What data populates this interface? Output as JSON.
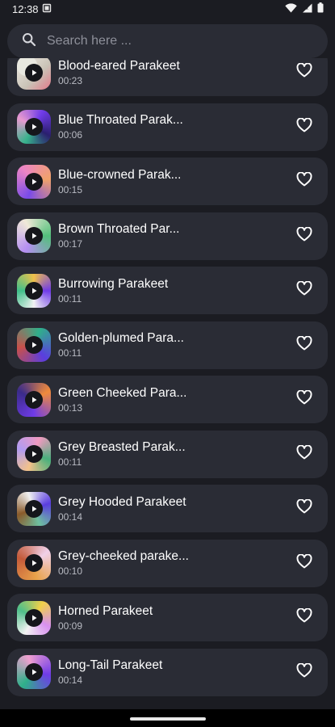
{
  "status_bar": {
    "time": "12:38"
  },
  "search": {
    "placeholder": "Search here ..."
  },
  "items": [
    {
      "title": "Blood-eared Parakeet",
      "duration": "00:23",
      "art": "a1"
    },
    {
      "title": "Blue Throated Parak...",
      "duration": "00:06",
      "art": "a2"
    },
    {
      "title": "Blue-crowned Parak...",
      "duration": "00:15",
      "art": "a3"
    },
    {
      "title": "Brown Throated Par...",
      "duration": "00:17",
      "art": "a4"
    },
    {
      "title": "Burrowing Parakeet",
      "duration": "00:11",
      "art": "a5"
    },
    {
      "title": "Golden-plumed Para...",
      "duration": "00:11",
      "art": "a6"
    },
    {
      "title": "Green Cheeked Para...",
      "duration": "00:13",
      "art": "a7"
    },
    {
      "title": "Grey Breasted Parak...",
      "duration": "00:11",
      "art": "a8"
    },
    {
      "title": "Grey Hooded Parakeet",
      "duration": "00:14",
      "art": "a9"
    },
    {
      "title": "Grey-cheeked parake...",
      "duration": "00:10",
      "art": "a10"
    },
    {
      "title": "Horned Parakeet",
      "duration": "00:09",
      "art": "a11"
    },
    {
      "title": "Long-Tail Parakeet",
      "duration": "00:14",
      "art": "a12"
    }
  ],
  "colors": {
    "background": "#1b1c22",
    "card": "#2a2c35",
    "text_primary": "#ffffff",
    "text_secondary": "#b9bbc3"
  },
  "icons": {
    "search": "search-icon",
    "favorite": "heart-outline-icon",
    "play": "play-icon"
  }
}
